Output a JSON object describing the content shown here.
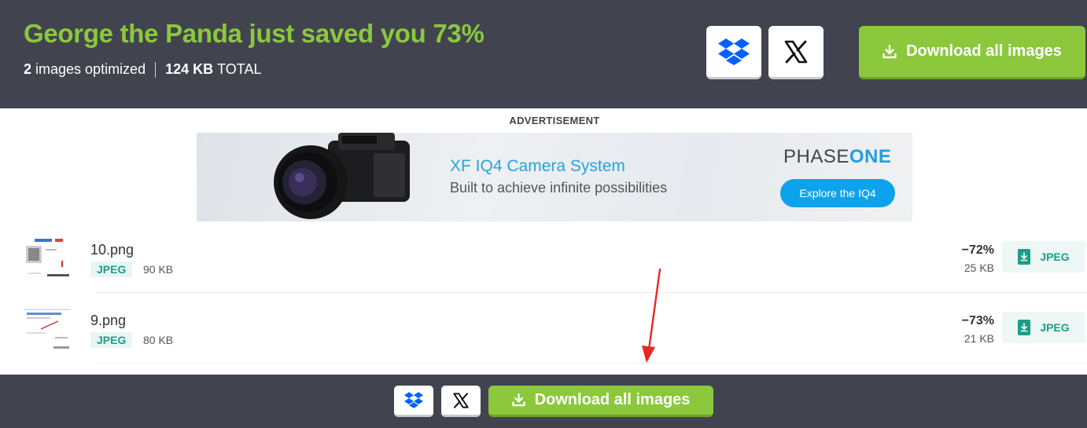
{
  "header": {
    "headline": "George the Panda just saved you 73%",
    "images_count": "2",
    "images_label": "images optimized",
    "total_size": "124 KB",
    "total_label": "TOTAL",
    "download_all_label": "Download all images"
  },
  "ad": {
    "label": "ADVERTISEMENT",
    "title": "XF IQ4 Camera System",
    "subtitle": "Built to achieve infinite possibilities",
    "brand_prefix": "PHASE",
    "brand_suffix": "ONE",
    "cta": "Explore the IQ4"
  },
  "files": [
    {
      "name": "10.png",
      "format": "JPEG",
      "original_size": "90 KB",
      "savings": "−72%",
      "new_size": "25 KB",
      "download_label": "JPEG"
    },
    {
      "name": "9.png",
      "format": "JPEG",
      "original_size": "80 KB",
      "savings": "−73%",
      "new_size": "21 KB",
      "download_label": "JPEG"
    }
  ],
  "footer": {
    "download_all_label": "Download all images"
  },
  "icons": {
    "dropbox": "dropbox-icon",
    "x": "x-logo-icon",
    "download": "download-icon"
  },
  "colors": {
    "accent_green": "#8bc83c",
    "dark_bar": "#41444f",
    "teal": "#1b9e86",
    "dropbox_blue": "#0061fe",
    "annotation_red": "#e8281e"
  }
}
